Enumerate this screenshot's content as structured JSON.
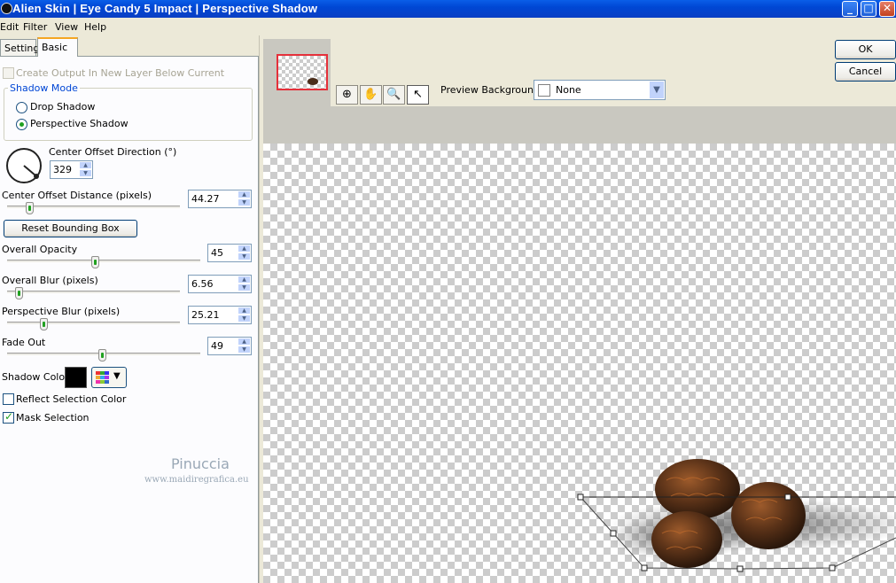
{
  "window": {
    "title": "Alien Skin | Eye Candy 5 Impact | Perspective Shadow",
    "minimize": "_",
    "maximize": "□",
    "close": "✕"
  },
  "menu": [
    "Edit",
    "Filter",
    "View",
    "Help"
  ],
  "tabs": [
    "Settings",
    "Basic"
  ],
  "basic": {
    "create_output_label": "Create Output In New Layer Below Current",
    "shadow_mode": {
      "title": "Shadow Mode",
      "options": [
        "Drop Shadow",
        "Perspective Shadow"
      ],
      "selected": "Perspective Shadow"
    },
    "center_offset_direction": {
      "label": "Center Offset Direction (°)",
      "value": "329"
    },
    "center_offset_distance": {
      "label": "Center Offset Distance (pixels)",
      "value": "44.27",
      "slider_fraction": 0.14
    },
    "reset_bounding_box_label": "Reset Bounding Box",
    "overall_opacity": {
      "label": "Overall Opacity",
      "value": "45",
      "slider_fraction": 0.45
    },
    "overall_blur": {
      "label": "Overall Blur (pixels)",
      "value": "6.56",
      "slider_fraction": 0.08
    },
    "perspective_blur": {
      "label": "Perspective Blur (pixels)",
      "value": "25.21",
      "slider_fraction": 0.22
    },
    "fade_out": {
      "label": "Fade Out",
      "value": "49",
      "slider_fraction": 0.49
    },
    "shadow_color": {
      "label": "Shadow Color",
      "value": "#000000"
    },
    "reflect_selection_color": {
      "label": "Reflect Selection Color",
      "checked": false
    },
    "mask_selection": {
      "label": "Mask Selection",
      "checked": true
    }
  },
  "watermark": {
    "name": "Pinuccia",
    "url": "www.maidiregrafica.eu"
  },
  "preview": {
    "background_label": "Preview Background:",
    "background_value": "None"
  },
  "buttons": {
    "ok": "OK",
    "cancel": "Cancel"
  },
  "toolbar_icons": [
    "zoom-fit-icon",
    "hand-pan-icon",
    "zoom-magnifier-icon",
    "arrow-pointer-icon"
  ]
}
